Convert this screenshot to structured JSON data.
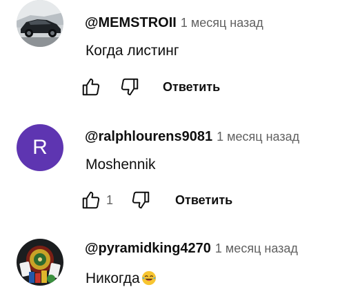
{
  "comments": [
    {
      "author": "@MEMSTROII",
      "time": "1 месяц назад",
      "text": "Когда листинг",
      "likes": "",
      "reply_label": "Ответить",
      "avatar": "car-photo"
    },
    {
      "author": "@ralphlourens9081",
      "time": "1 месяц назад",
      "text": "Moshennik",
      "likes": "1",
      "reply_label": "Ответить",
      "avatar": "letter",
      "avatar_letter": "R",
      "avatar_color": "#5e35b1"
    },
    {
      "author": "@pyramidking4270",
      "time": "1 месяц назад",
      "text": "Никогда",
      "emoji": "laughing-tears-emoji",
      "avatar": "casino-image"
    }
  ],
  "icons": {
    "like": "thumb-up-icon",
    "dislike": "thumb-down-icon"
  },
  "colors": {
    "text_primary": "#0f0f0f",
    "text_secondary": "#606060",
    "avatar_purple": "#5e35b1"
  }
}
